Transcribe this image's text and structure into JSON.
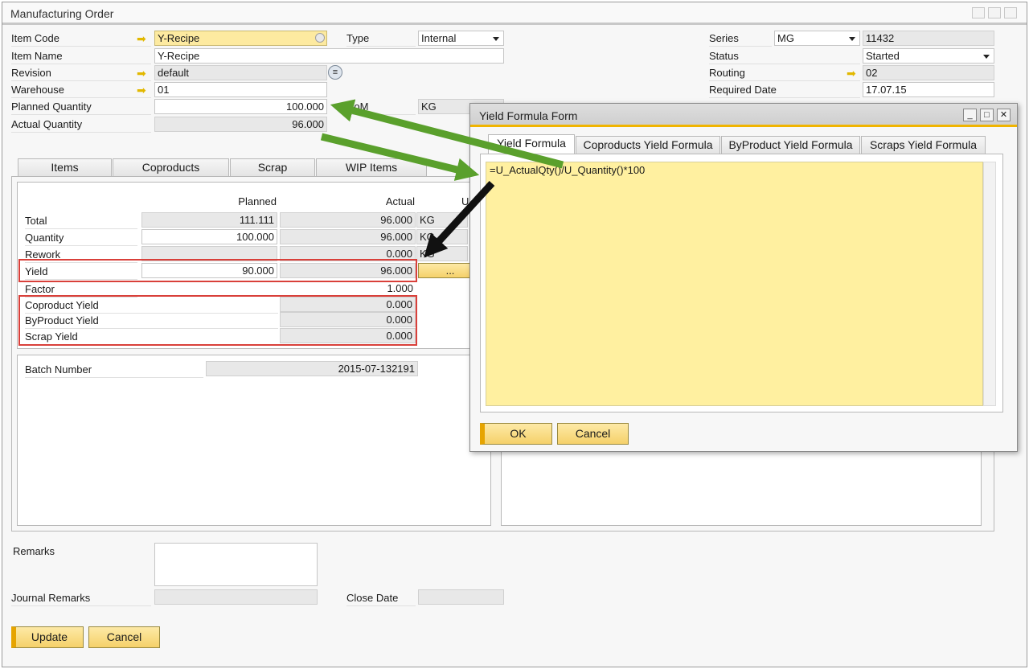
{
  "window": {
    "title": "Manufacturing Order"
  },
  "header": {
    "item_code": {
      "label": "Item Code",
      "value": "Y-Recipe"
    },
    "item_name": {
      "label": "Item Name",
      "value": "Y-Recipe"
    },
    "revision": {
      "label": "Revision",
      "value": "default"
    },
    "warehouse": {
      "label": "Warehouse",
      "value": "01"
    },
    "planned_quantity": {
      "label": "Planned Quantity",
      "value": "100.000"
    },
    "actual_quantity": {
      "label": "Actual Quantity",
      "value": "96.000"
    },
    "type": {
      "label": "Type",
      "value": "Internal"
    },
    "uom": {
      "label": "UoM",
      "value": "KG"
    },
    "series": {
      "label": "Series",
      "value": "MG",
      "number": "11432"
    },
    "status": {
      "label": "Status",
      "value": "Started"
    },
    "routing": {
      "label": "Routing",
      "value": "02"
    },
    "required_date": {
      "label": "Required Date",
      "value": "17.07.15"
    }
  },
  "tabs": [
    {
      "label": "Items"
    },
    {
      "label": "Coproducts"
    },
    {
      "label": "Scrap"
    },
    {
      "label": "WIP Items"
    }
  ],
  "summary": {
    "col_planned": "Planned",
    "col_actual": "Actual",
    "col_u": "U",
    "rows": [
      {
        "label": "Total",
        "planned": "111.111",
        "actual": "96.000",
        "unit": "KG"
      },
      {
        "label": "Quantity",
        "planned": "100.000",
        "actual": "96.000",
        "unit": "KG"
      },
      {
        "label": "Rework",
        "planned": "",
        "actual": "0.000",
        "unit": "KG"
      },
      {
        "label": "Yield",
        "planned": "90.000",
        "actual": "96.000",
        "unit": "..."
      },
      {
        "label": "Factor",
        "planned": "",
        "actual": "1.000",
        "unit": ""
      },
      {
        "label": "Coproduct Yield",
        "planned": "",
        "actual": "0.000",
        "unit": ""
      },
      {
        "label": "ByProduct Yield",
        "planned": "",
        "actual": "0.000",
        "unit": ""
      },
      {
        "label": "Scrap Yield",
        "planned": "",
        "actual": "0.000",
        "unit": ""
      }
    ],
    "batch_label": "Batch Number",
    "batch_value": "2015-07-132191"
  },
  "footer": {
    "remarks_label": "Remarks",
    "journal_label": "Journal Remarks",
    "close_date_label": "Close Date",
    "update_button": "Update",
    "cancel_button": "Cancel"
  },
  "dialog": {
    "title": "Yield Formula Form",
    "tabs": [
      "Yield Formula",
      "Coproducts Yield Formula",
      "ByProduct Yield Formula",
      "Scraps Yield Formula"
    ],
    "formula": "=U_ActualQty()/U_Quantity()*100",
    "ok_button": "OK",
    "cancel_button": "Cancel"
  },
  "colors": {
    "accent_yellow": "#fdeaa0",
    "highlight_red": "#d9403a",
    "arrow_green": "#5aa02c",
    "arrow_black": "#111111"
  },
  "icons": [
    "link-arrow-icon",
    "dropdown-arrow-icon",
    "list-icon",
    "minimize-icon",
    "maximize-icon",
    "close-icon"
  ]
}
